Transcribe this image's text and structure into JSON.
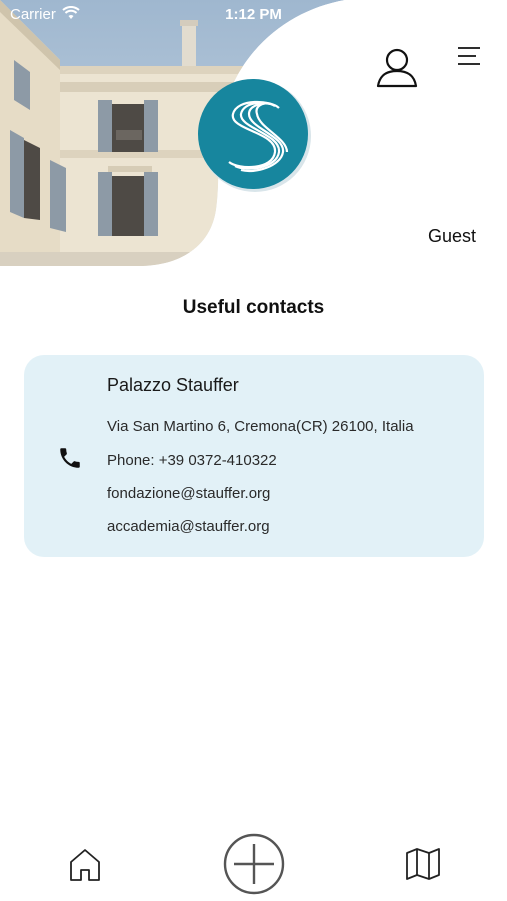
{
  "status_bar": {
    "carrier": "Carrier",
    "time": "1:12 PM"
  },
  "header": {
    "user_label": "Guest"
  },
  "page": {
    "title": "Useful contacts"
  },
  "contact": {
    "name": "Palazzo Stauffer",
    "address": "Via San Martino 6, Cremona(CR) 26100, Italia",
    "phone": "Phone: +39 0372-410322",
    "email_1": "fondazione@stauffer.org",
    "email_2": "accademia@stauffer.org"
  },
  "colors": {
    "accent": "#17869e",
    "card_bg": "#e2f1f7",
    "icon_gray": "#555555"
  },
  "icons": {
    "user": "user-icon",
    "menu": "hamburger-menu-icon",
    "phone": "phone-icon",
    "home": "home-icon",
    "add": "plus-circle-icon",
    "map": "map-icon"
  }
}
